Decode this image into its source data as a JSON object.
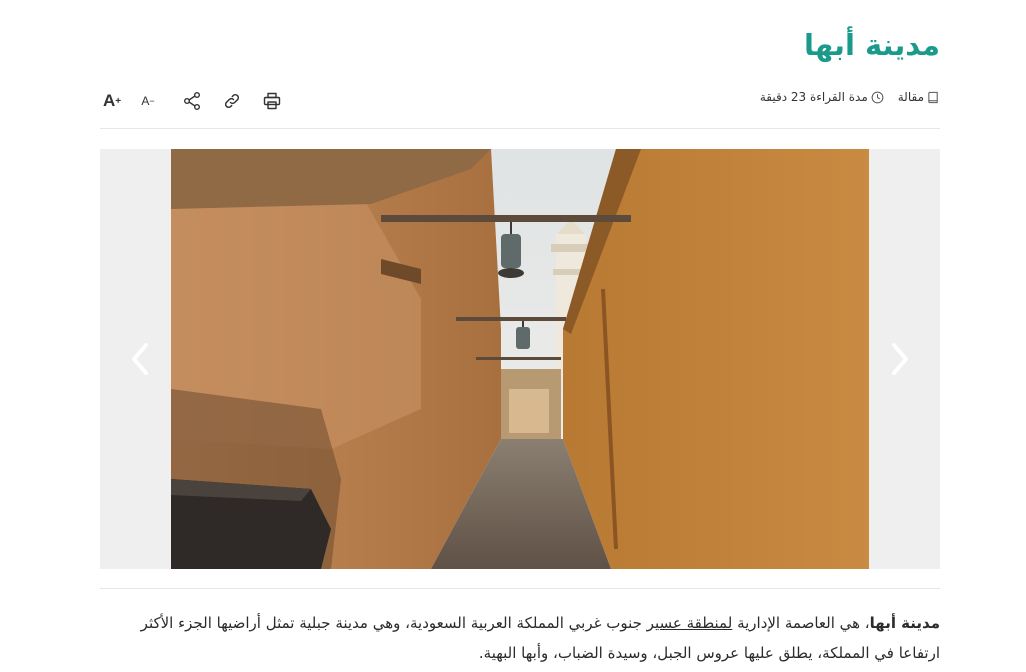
{
  "article": {
    "title": "مدينة أبها",
    "meta": {
      "type_label": "مقالة",
      "reading_time": "مدة القراءة 23 دقيقة"
    },
    "toolbar": {
      "font_increase": "A",
      "font_increase_sup": "+",
      "font_decrease": "A",
      "font_decrease_sup": "−"
    },
    "gallery": {
      "prev_icon": "chevron-left-icon",
      "next_icon": "chevron-right-icon"
    },
    "paragraph": {
      "lead_bold": "مدينة أبها",
      "part1": "، هي العاصمة الإدارية ",
      "link_text": "لمنطقة عسير",
      "part2": " جنوب غربي المملكة العربية السعودية، وهي مدينة جبلية تمثل أراضيها الجزء الأكثر ارتفاعا في المملكة، يطلق عليها عروس الجبل، وسيدة الضباب، وأبها البهية."
    }
  },
  "colors": {
    "title": "#1a9a8b",
    "gallery_bg": "#efefef"
  }
}
